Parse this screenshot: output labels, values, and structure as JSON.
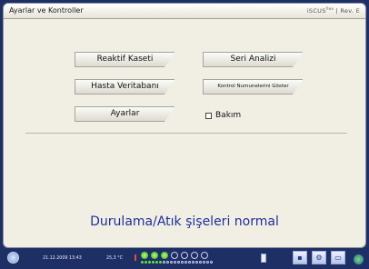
{
  "window": {
    "title": "Ayarlar ve Kontroller",
    "brand": "iSCUS",
    "brand_superscript": "flex",
    "brand_suffix": "| Rev. E"
  },
  "menu": {
    "reagent_cassette": "Reaktif Kaseti",
    "series_analysis": "Seri Analizi",
    "patient_database": "Hasta Veritabanı",
    "show_control_samples": "Kontrol Numunelerini Göster",
    "settings": "Ayarlar",
    "maintenance_label": "Bakım",
    "maintenance_checked": false
  },
  "status_message": "Durulama/Atık şişeleri normal",
  "taskbar": {
    "datetime": "21.12.2009 13:43",
    "temperature": "25,3 °C",
    "indicator_states": [
      "on",
      "on",
      "on",
      "off",
      "off",
      "off",
      "off"
    ],
    "mini_indicator_states": [
      "on",
      "on",
      "on",
      "on",
      "on",
      "on",
      "off",
      "off",
      "off",
      "off",
      "off",
      "off",
      "off",
      "off",
      "off",
      "off",
      "off",
      "off",
      "off",
      "off"
    ]
  }
}
